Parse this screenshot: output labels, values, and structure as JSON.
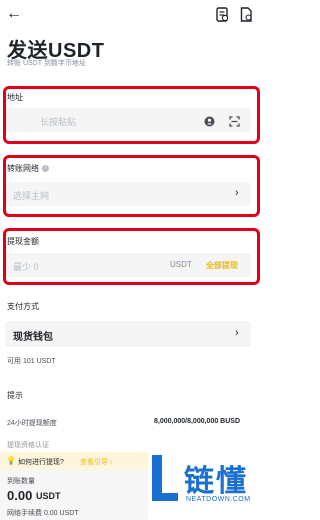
{
  "header": {
    "back_icon": "arrow-left-icon",
    "title": "发送USDT",
    "subtitle": "转账 USDT 到数字币地址",
    "icons": [
      "history-icon",
      "file-icon"
    ]
  },
  "address": {
    "label": "地址",
    "placeholder": "长按粘贴",
    "icons": [
      "contact-icon",
      "scan-icon"
    ]
  },
  "network": {
    "label": "转账网络",
    "placeholder": "选择主网"
  },
  "amount": {
    "label": "提现金额",
    "placeholder": "最少 0",
    "currency": "USDT",
    "max_label": "全部提现"
  },
  "payment": {
    "label": "支付方式",
    "value": "现货钱包",
    "available": "可用 101 USDT"
  },
  "notice": {
    "label": "提示",
    "limit_label": "24小时提现额度",
    "limit_value": "8,000,000/8,000,000 BUSD",
    "partial_row": "提现资格认证"
  },
  "tip": {
    "text": "如何进行提现?",
    "link": "查看引导 ›"
  },
  "bottom": {
    "receive_label": "到账数量",
    "receive_value": "0.00",
    "receive_unit": "USDT",
    "fee_text": "网络手续费 0.00 USDT"
  },
  "watermark": {
    "brand": "链懂",
    "url": "NEATDOWN.COM"
  },
  "colors": {
    "accent": "#f0b90b",
    "highlight_border": "#e0001a"
  }
}
